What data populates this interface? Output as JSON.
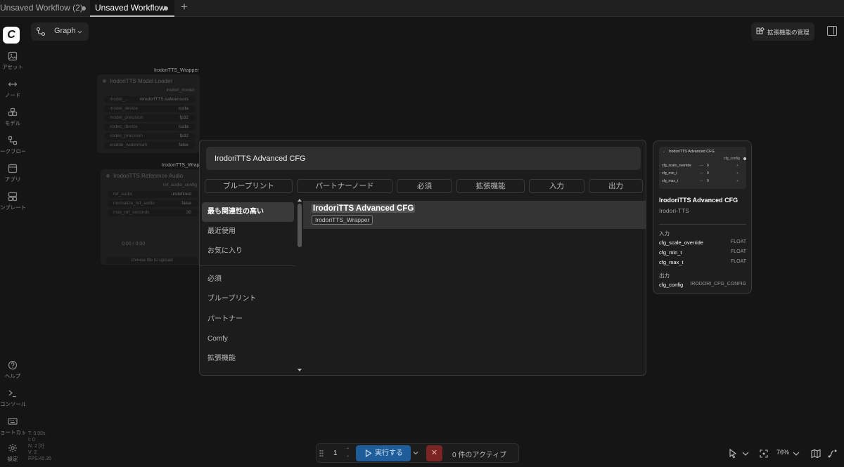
{
  "tabs": [
    {
      "label": "Unsaved Workflow (2)",
      "modified": true,
      "active": false
    },
    {
      "label": "Unsaved Workflow",
      "modified": true,
      "active": true
    }
  ],
  "tab_add": "+",
  "sidebar": {
    "logo": "C",
    "items": [
      {
        "label": "アセット",
        "icon": "image-icon"
      },
      {
        "label": "ノード",
        "icon": "nodes-icon"
      },
      {
        "label": "モデル",
        "icon": "model-icon"
      },
      {
        "label": "ークフロー",
        "icon": "workflow-icon"
      },
      {
        "label": "アプリ",
        "icon": "app-icon"
      },
      {
        "label": "ンプレート",
        "icon": "template-icon"
      }
    ],
    "bottom_items": [
      {
        "label": "ヘルプ",
        "icon": "help-icon"
      },
      {
        "label": "コンソール",
        "icon": "console-icon"
      },
      {
        "label": "ョートカッ",
        "icon": "keyboard-icon"
      },
      {
        "label": "設定",
        "icon": "gear-icon"
      }
    ]
  },
  "stats": [
    "T: 0.00s",
    "I: 0",
    "N: 2 [2]",
    "V: 2",
    "FPS:42.35"
  ],
  "toolbar": {
    "graph_label": "Graph",
    "extensions_label": "拡張機能の管理"
  },
  "canvas": {
    "group1": "IrodoriTTS_Wrapper",
    "group2": "IrodoriTTS_Wrapp",
    "node1": {
      "title": "IrodoriTTS Model Loader",
      "output": "irodori_model",
      "widgets": [
        {
          "k": "model_...",
          "v": "#irodoriTTS.safetensors"
        },
        {
          "k": "model_device",
          "v": "cuda"
        },
        {
          "k": "model_precision",
          "v": "fp32"
        },
        {
          "k": "codec_device",
          "v": "cuda"
        },
        {
          "k": "codec_precision",
          "v": "fp32"
        },
        {
          "k": "enable_watermark",
          "v": "false"
        }
      ]
    },
    "node2": {
      "title": "IrodoriTTS Reference Audio",
      "output": "ref_audio_config",
      "widgets": [
        {
          "k": "ref_audio",
          "v": "undefined"
        },
        {
          "k": "normalize_ref_audio",
          "v": "false"
        },
        {
          "k": "max_ref_seconds",
          "v": "30"
        }
      ],
      "audio_time": "0:00 / 0:00",
      "upload": "choose file to upload"
    }
  },
  "search": {
    "query": "IrodoriTTS Advanced CFG",
    "filters": [
      "ブループリント",
      "パートナーノード",
      "必須",
      "拡張機能",
      "入力",
      "出力"
    ],
    "categories": [
      "最も関連性の高い",
      "最近使用",
      "お気に入り",
      "必須",
      "ブループリント",
      "パートナー",
      "Comfy",
      "拡張機能"
    ],
    "results": [
      {
        "name": "IrodoriTTS Advanced CFG",
        "package": "IrodoriTTS_Wrapper"
      }
    ]
  },
  "preview": {
    "mini_title": "IrodoriTTS Advanced CFG",
    "mini_output": "cfg_config",
    "mini_rows": [
      {
        "k": "cfg_scale_override",
        "v": "0"
      },
      {
        "k": "cfg_min_t",
        "v": "0"
      },
      {
        "k": "cfg_max_t",
        "v": "0"
      }
    ],
    "title": "IrodoriTTS Advanced CFG",
    "package": "Irodori-TTS",
    "inputs_label": "入力",
    "inputs": [
      {
        "name": "cfg_scale_override",
        "type": "FLOAT"
      },
      {
        "name": "cfg_min_t",
        "type": "FLOAT"
      },
      {
        "name": "cfg_max_t",
        "type": "FLOAT"
      }
    ],
    "outputs_label": "出力",
    "outputs": [
      {
        "name": "cfg_config",
        "type": "IRODORI_CFG_CONFIG"
      }
    ]
  },
  "run_bar": {
    "count": "1",
    "run_label": "実行する",
    "stop": "✕",
    "active": "0 件のアクティブ"
  },
  "zoom": "76%"
}
